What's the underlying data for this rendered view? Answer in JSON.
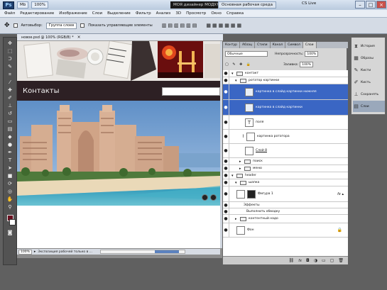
{
  "titlebar": {
    "logo": "Ps",
    "mode_button": "Mb",
    "zoom": "100%",
    "workspace_menu": "МОЯ дизайнер МОДУЛ",
    "workspace_name": "Основная рабочая среда",
    "cs_live": "CS Live"
  },
  "menu": [
    "Файл",
    "Редактирование",
    "Изображение",
    "Слои",
    "Выделение",
    "Фильтр",
    "Анализ",
    "3D",
    "Просмотр",
    "Окно",
    "Справка"
  ],
  "options": {
    "auto_select": "Автовыбор:",
    "auto_select_value": "Группа слоев",
    "show_controls": "Показать управляющие элементы"
  },
  "document": {
    "tab_title": "новое.psd @ 100% (RGB/8) *",
    "header_title": "Контакты",
    "zoom": "100%",
    "status": "Экспозиция рабочей только в ..."
  },
  "layers_panel": {
    "tabs": [
      "Контур",
      "Абзац",
      "Стили",
      "Канал",
      "Символ",
      "Слои"
    ],
    "blend_mode": "Обычные",
    "opacity_label": "Непрозрачность:",
    "opacity_value": "100%",
    "fill_label": "Заливка:",
    "fill_value": "100%",
    "layers": [
      {
        "name": "контакт",
        "kind": "folder",
        "selected": false
      },
      {
        "name": "ротатор картинки",
        "kind": "folder",
        "selected": false
      },
      {
        "name": "картинка в слайд картинки нижняя",
        "kind": "image",
        "selected": true
      },
      {
        "name": "картинка в слайд картинки",
        "kind": "image",
        "selected": true
      },
      {
        "name": "поля",
        "kind": "text",
        "selected": false
      },
      {
        "name": "картинка ротатора",
        "kind": "image",
        "selected": false
      },
      {
        "name": "Слой 8",
        "kind": "image",
        "selected": false
      },
      {
        "name": "поиск",
        "kind": "folder",
        "selected": false
      },
      {
        "name": "меню",
        "kind": "folder",
        "selected": false
      },
      {
        "name": "header",
        "kind": "folder",
        "selected": false
      },
      {
        "name": "шапка",
        "kind": "folder",
        "selected": false
      },
      {
        "name": "Фигура 1",
        "kind": "shape",
        "selected": false
      },
      {
        "name": "Эффекты",
        "kind": "effect",
        "selected": false
      },
      {
        "name": "Выполнить обводку",
        "kind": "effect",
        "selected": false
      },
      {
        "name": "контентный надо",
        "kind": "folder",
        "selected": false
      },
      {
        "name": "Фон",
        "kind": "image",
        "selected": false
      }
    ]
  },
  "dock": [
    "История",
    "Образы",
    "Кисти",
    "Кисть",
    "Сохранять",
    "Слои"
  ]
}
